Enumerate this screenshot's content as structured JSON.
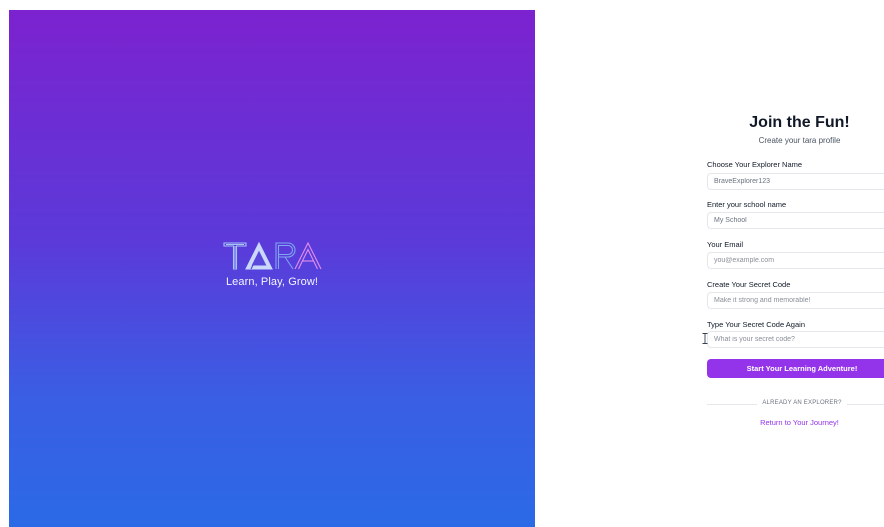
{
  "brand": {
    "logo_text": "TARA",
    "tagline": "Learn, Play, Grow!"
  },
  "signup": {
    "title": "Join the Fun!",
    "subtitle": "Create your tara profile",
    "fields": [
      {
        "label": "Choose Your Explorer Name",
        "value": "BraveExplorer123",
        "placeholder": ""
      },
      {
        "label": "Enter your school name",
        "value": "My School",
        "placeholder": ""
      },
      {
        "label": "Your Email",
        "value": "",
        "placeholder": "you@example.com"
      },
      {
        "label": "Create Your Secret Code",
        "value": "",
        "placeholder": "Make it strong and memorable!"
      },
      {
        "label": "Type Your Secret Code Again",
        "value": "",
        "placeholder": "What is your secret code?"
      }
    ],
    "submit_label": "Start Your Learning Adventure!",
    "divider_text": "ALREADY AN EXPLORER?",
    "login_link": "Return to Your Journey!"
  },
  "colors": {
    "gradient_top": "#7c22cf",
    "gradient_bottom": "#2b6ae6",
    "accent": "#9333ea"
  }
}
